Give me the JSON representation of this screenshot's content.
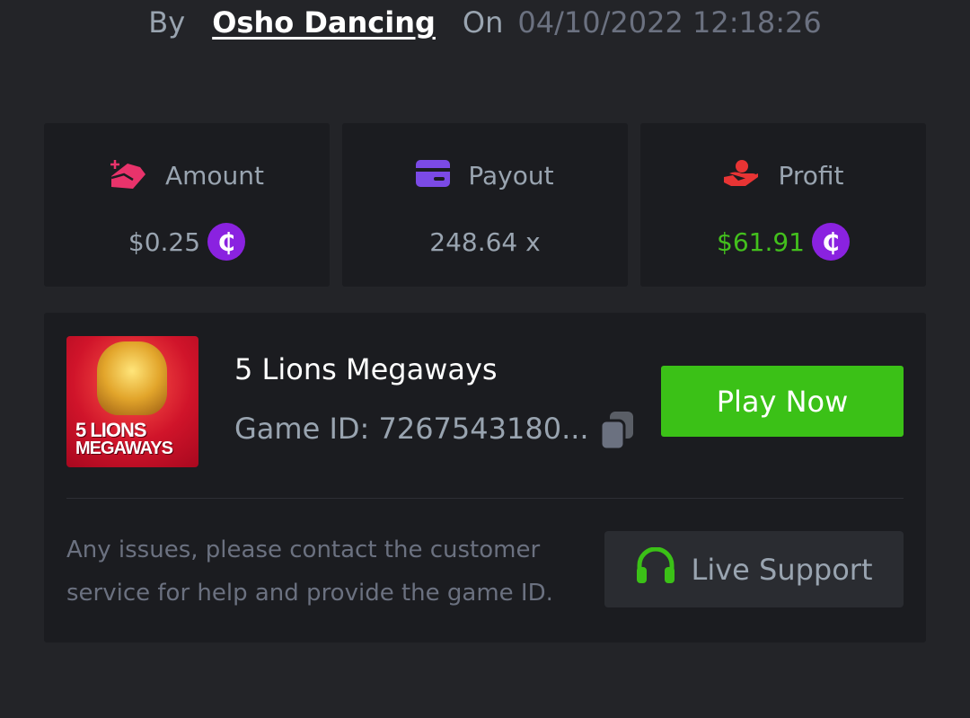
{
  "byline": {
    "by_label": "By",
    "username": "Osho Dancing",
    "on_label": "On",
    "datetime": "04/10/2022 12:18:26"
  },
  "stats": {
    "amount": {
      "label": "Amount",
      "value": "$0.25",
      "icon": "bet-amount-icon",
      "coin": "₵"
    },
    "payout": {
      "label": "Payout",
      "value": "248.64 x",
      "icon": "card-icon"
    },
    "profit": {
      "label": "Profit",
      "value": "$61.91",
      "icon": "hand-coin-icon",
      "coin": "₵",
      "color": "#43c01d"
    }
  },
  "game": {
    "thumbnail_text_line1": "5 LIONS",
    "thumbnail_text_line2": "MEGAWAYS",
    "name": "5 Lions Megaways",
    "id_text": "Game ID: 7267543180...",
    "play_label": "Play Now"
  },
  "support": {
    "help_text": "Any issues, please contact the customer service for help and provide the game ID.",
    "button_label": "Live Support"
  },
  "colors": {
    "background": "#232428",
    "card": "#1b1c20",
    "accent_green": "#3bc117",
    "coin_purple": "#8a22e0",
    "amount_icon": "#e8336b",
    "payout_icon": "#7b4ae6",
    "profit_icon": "#e83434"
  }
}
